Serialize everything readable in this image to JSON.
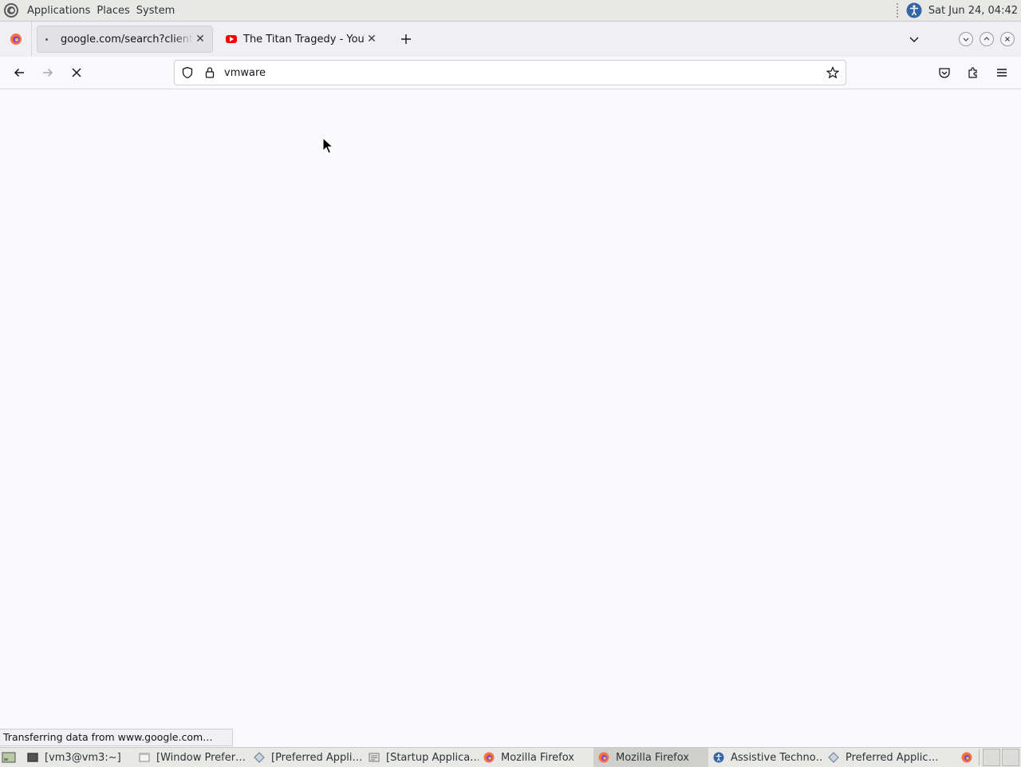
{
  "top_panel": {
    "menus": [
      "Applications",
      "Places",
      "System"
    ],
    "clock": "Sat Jun 24, 04:42"
  },
  "tabs": [
    {
      "label": "google.com/search?client=firefox",
      "active": true,
      "loading": true
    },
    {
      "label": "The Titan Tragedy - YouTube",
      "active": false
    }
  ],
  "urlbar": {
    "value": "vmware"
  },
  "status": {
    "text": "Transferring data from www.google.com…"
  },
  "taskbar": {
    "items": [
      {
        "label": "[vm3@vm3:~]",
        "icon": "terminal-icon"
      },
      {
        "label": "[Window Prefer…",
        "icon": "window-icon"
      },
      {
        "label": "[Preferred Appli…",
        "icon": "preferences-icon"
      },
      {
        "label": "[Startup Applica…",
        "icon": "startup-icon"
      },
      {
        "label": "Mozilla Firefox",
        "icon": "firefox-icon"
      },
      {
        "label": "Mozilla Firefox",
        "icon": "firefox-icon",
        "active": true
      },
      {
        "label": "Assistive Techno…",
        "icon": "accessibility-icon"
      },
      {
        "label": "Preferred Applic…",
        "icon": "preferences-icon"
      }
    ]
  },
  "colors": {
    "firefox_orange": "#ff7139",
    "firefox_purple": "#7542e5",
    "youtube_red": "#ff0000",
    "accessibility_blue": "#3465a4"
  }
}
